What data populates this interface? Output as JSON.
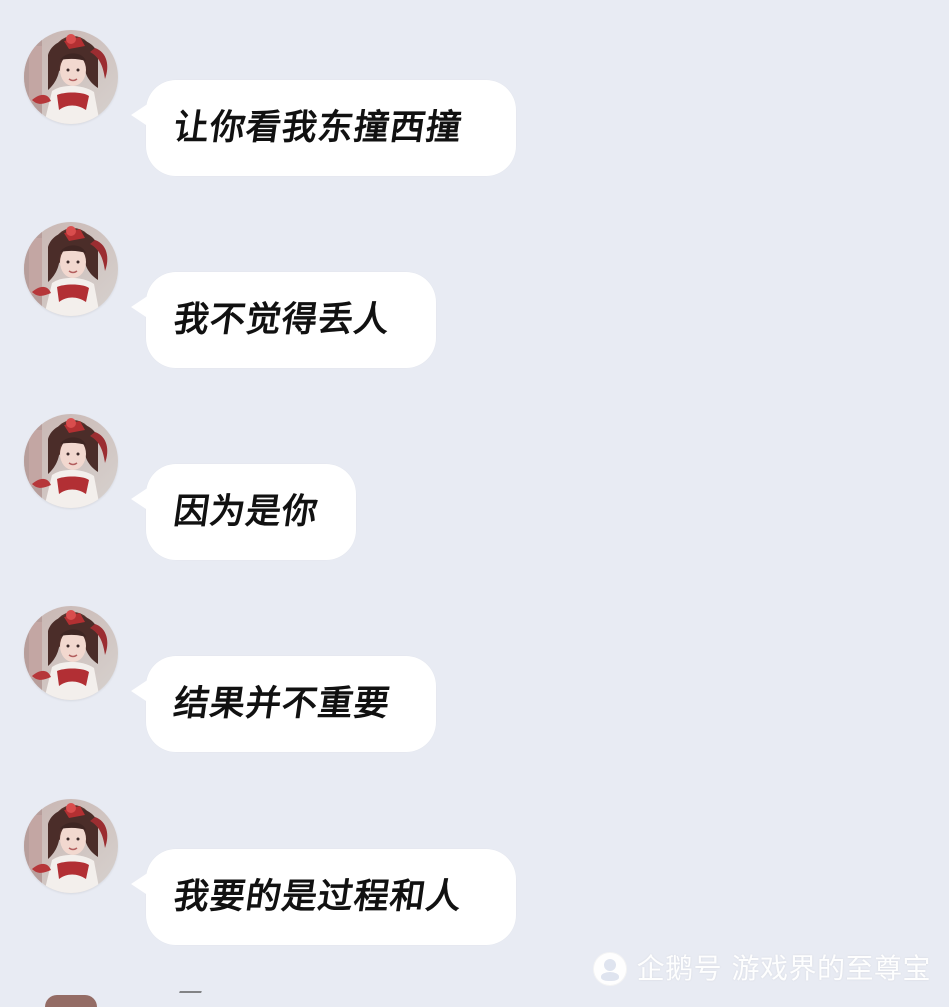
{
  "messages": [
    {
      "text": "让你看我东撞西撞",
      "avatar": "portrait-avatar"
    },
    {
      "text": "我不觉得丢人",
      "avatar": "portrait-avatar"
    },
    {
      "text": "因为是你",
      "avatar": "portrait-avatar"
    },
    {
      "text": "结果并不重要",
      "avatar": "portrait-avatar"
    },
    {
      "text": "我要的是过程和人",
      "avatar": "portrait-avatar"
    }
  ],
  "watermark": {
    "text": "企鹅号 游戏界的至尊宝",
    "icon": "penguin-icon"
  },
  "colors": {
    "background": "#e8ebf3",
    "bubble": "#ffffff",
    "text": "#111111"
  }
}
